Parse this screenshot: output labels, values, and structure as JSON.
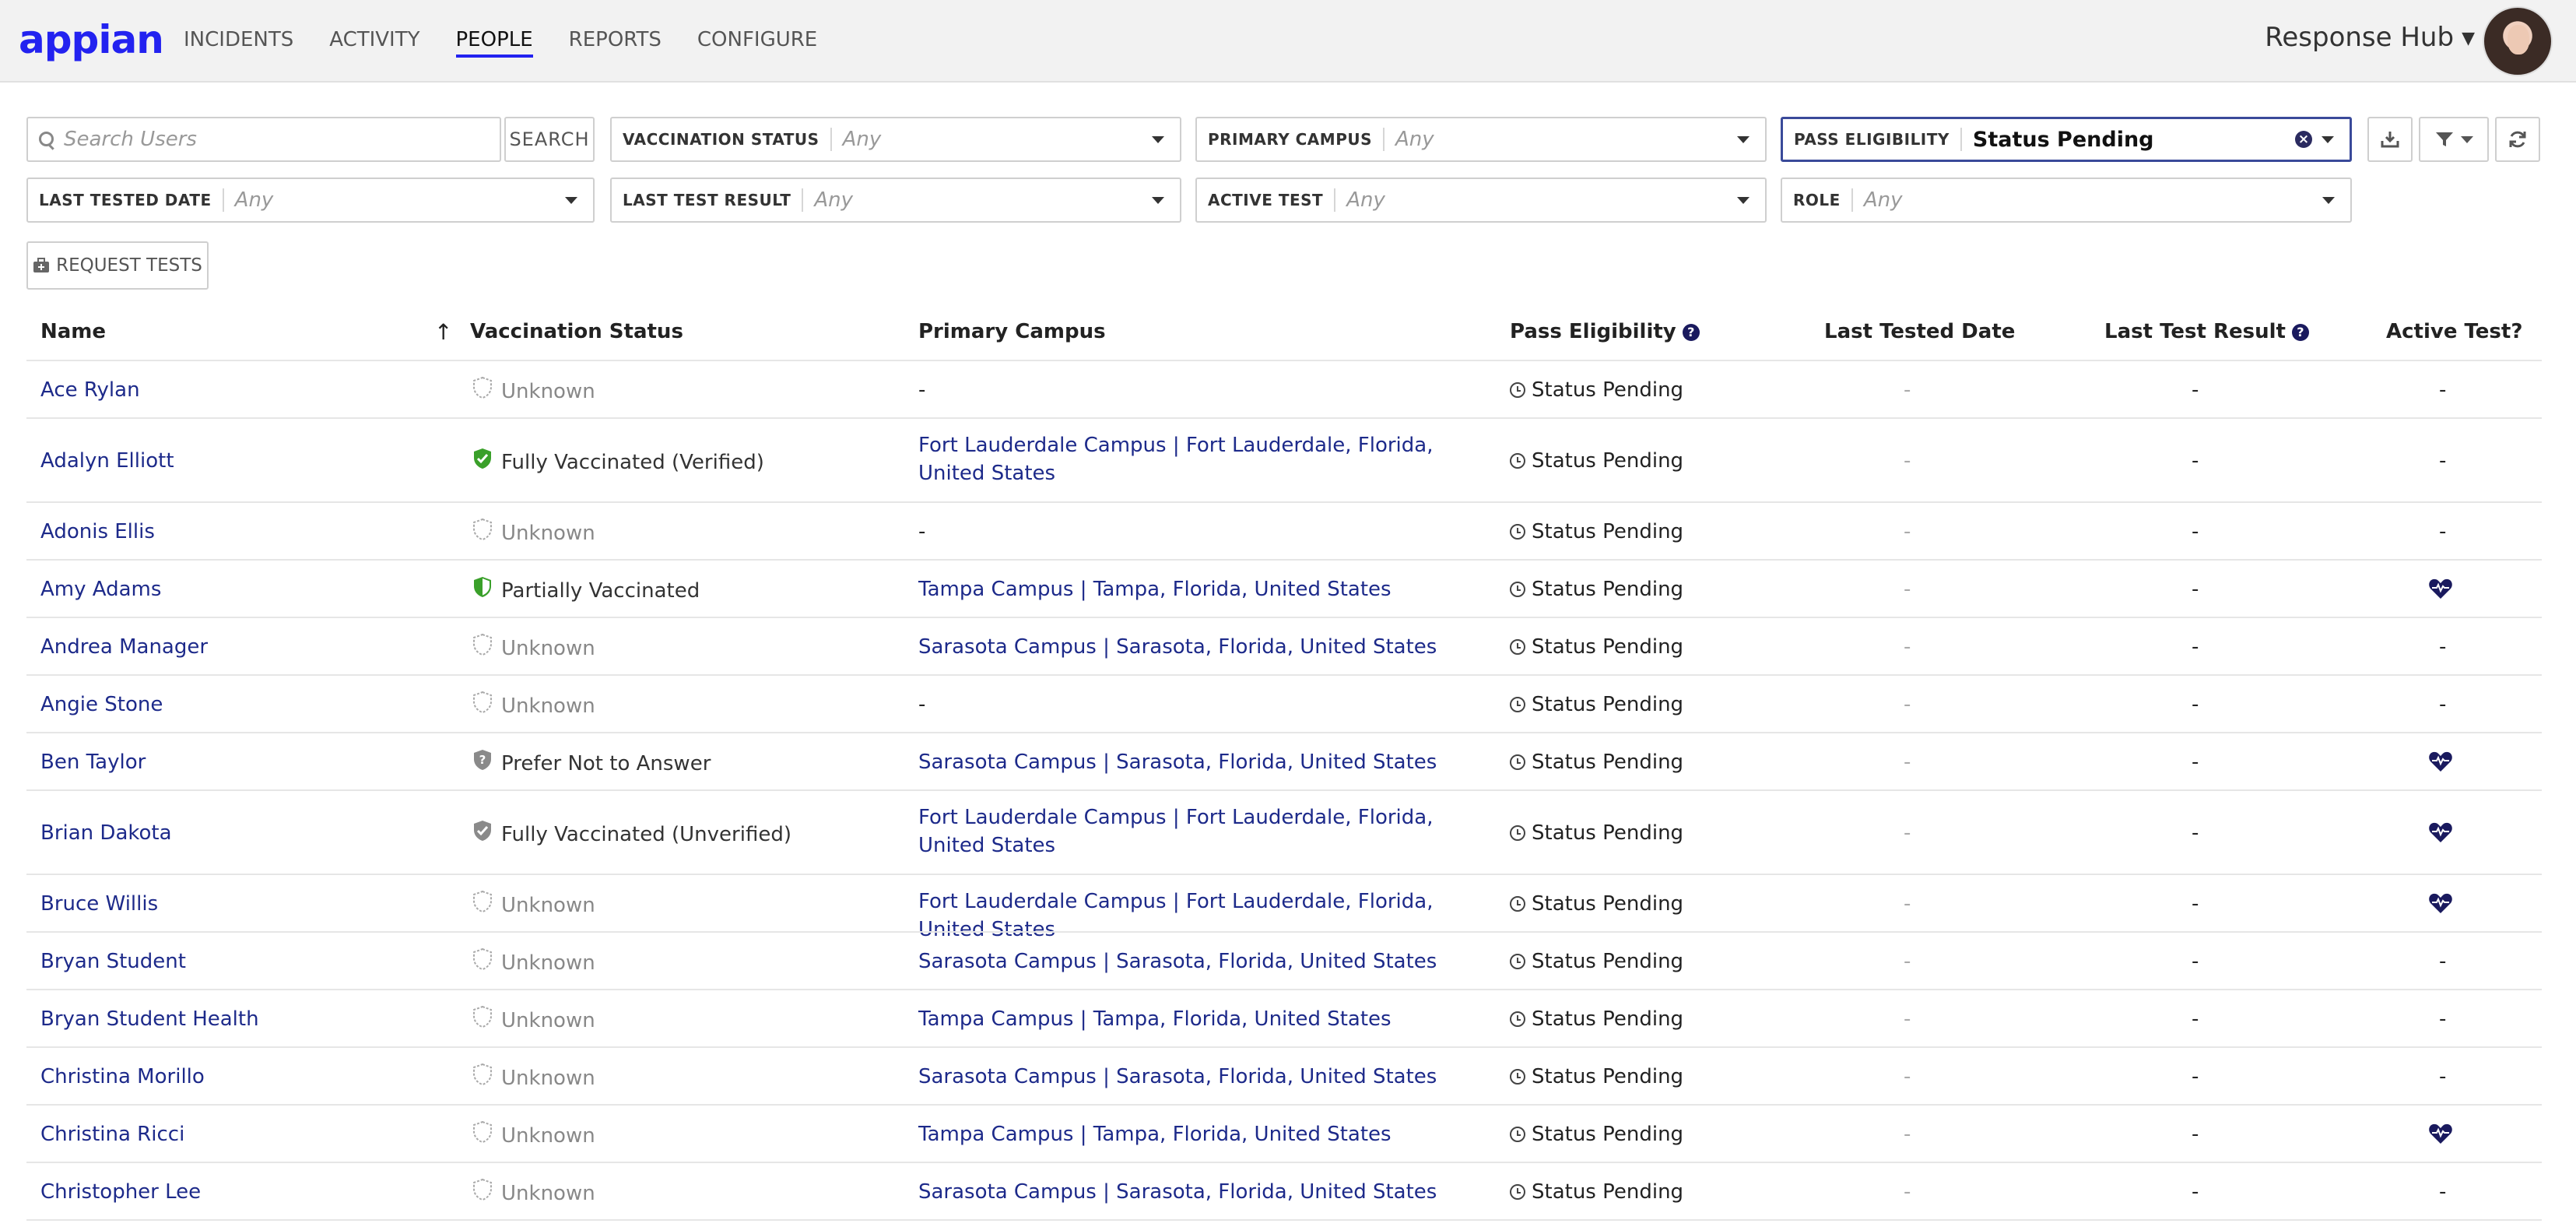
{
  "app": {
    "logo": "appian",
    "site_name": "Response Hub",
    "nav": [
      "INCIDENTS",
      "ACTIVITY",
      "PEOPLE",
      "REPORTS",
      "CONFIGURE"
    ],
    "active_nav": "PEOPLE"
  },
  "toolbar": {
    "search_placeholder": "Search Users",
    "search_button": "SEARCH",
    "request_tests_button": "REQUEST TESTS",
    "filters": [
      {
        "label": "VACCINATION STATUS",
        "value": "Any"
      },
      {
        "label": "PRIMARY CAMPUS",
        "value": "Any"
      },
      {
        "label": "PASS ELIGIBILITY",
        "value": "Status Pending"
      },
      {
        "label": "LAST TESTED DATE",
        "value": "Any"
      },
      {
        "label": "LAST TEST RESULT",
        "value": "Any"
      },
      {
        "label": "ACTIVE TEST",
        "value": "Any"
      },
      {
        "label": "ROLE",
        "value": "Any"
      }
    ]
  },
  "table": {
    "columns": [
      "Name",
      "Vaccination Status",
      "Primary Campus",
      "Pass Eligibility",
      "Last Tested Date",
      "Last Test Result",
      "Active Test?"
    ],
    "rows": [
      {
        "name": "Ace Rylan",
        "vax": "Unknown",
        "campus": "-",
        "pass": "Status Pending",
        "last_date": "-",
        "last_result": "-",
        "active": "-"
      },
      {
        "name": "Adalyn Elliott",
        "vax": "Fully Vaccinated (Verified)",
        "campus": "Fort Lauderdale Campus | Fort Lauderdale, Florida, United States",
        "pass": "Status Pending",
        "last_date": "-",
        "last_result": "-",
        "active": "-"
      },
      {
        "name": "Adonis Ellis",
        "vax": "Unknown",
        "campus": "-",
        "pass": "Status Pending",
        "last_date": "-",
        "last_result": "-",
        "active": "-"
      },
      {
        "name": "Amy Adams",
        "vax": "Partially Vaccinated",
        "campus": "Tampa Campus | Tampa, Florida, United States",
        "pass": "Status Pending",
        "last_date": "-",
        "last_result": "-",
        "active": "heart"
      },
      {
        "name": "Andrea Manager",
        "vax": "Unknown",
        "campus": "Sarasota Campus | Sarasota, Florida, United States",
        "pass": "Status Pending",
        "last_date": "-",
        "last_result": "-",
        "active": "-"
      },
      {
        "name": "Angie Stone",
        "vax": "Unknown",
        "campus": "-",
        "pass": "Status Pending",
        "last_date": "-",
        "last_result": "-",
        "active": "-"
      },
      {
        "name": "Ben Taylor",
        "vax": "Prefer Not to Answer",
        "campus": "Sarasota Campus | Sarasota, Florida, United States",
        "pass": "Status Pending",
        "last_date": "-",
        "last_result": "-",
        "active": "heart"
      },
      {
        "name": "Brian Dakota",
        "vax": "Fully Vaccinated (Unverified)",
        "campus": "Fort Lauderdale Campus | Fort Lauderdale, Florida, United States",
        "pass": "Status Pending",
        "last_date": "-",
        "last_result": "-",
        "active": "heart"
      },
      {
        "name": "Bruce Willis",
        "vax": "Unknown",
        "campus": "Fort Lauderdale Campus | Fort Lauderdale, Florida, United States",
        "pass": "Status Pending",
        "last_date": "-",
        "last_result": "-",
        "active": "heart"
      },
      {
        "name": "Bryan Student",
        "vax": "Unknown",
        "campus": "Sarasota Campus | Sarasota, Florida, United States",
        "pass": "Status Pending",
        "last_date": "-",
        "last_result": "-",
        "active": "-"
      },
      {
        "name": "Bryan Student Health",
        "vax": "Unknown",
        "campus": "Tampa Campus | Tampa, Florida, United States",
        "pass": "Status Pending",
        "last_date": "-",
        "last_result": "-",
        "active": "-"
      },
      {
        "name": "Christina Morillo",
        "vax": "Unknown",
        "campus": "Sarasota Campus | Sarasota, Florida, United States",
        "pass": "Status Pending",
        "last_date": "-",
        "last_result": "-",
        "active": "-"
      },
      {
        "name": "Christina Ricci",
        "vax": "Unknown",
        "campus": "Tampa Campus | Tampa, Florida, United States",
        "pass": "Status Pending",
        "last_date": "-",
        "last_result": "-",
        "active": "heart"
      },
      {
        "name": "Christopher Lee",
        "vax": "Unknown",
        "campus": "Sarasota Campus | Sarasota, Florida, United States",
        "pass": "Status Pending",
        "last_date": "-",
        "last_result": "-",
        "active": "-"
      }
    ]
  },
  "colors": {
    "brand": "#2322f0",
    "link": "#1d2a8a",
    "verified_green": "#3aa02a",
    "unverified_gray": "#8a8a8a",
    "heart_navy": "#1a1a5e"
  }
}
